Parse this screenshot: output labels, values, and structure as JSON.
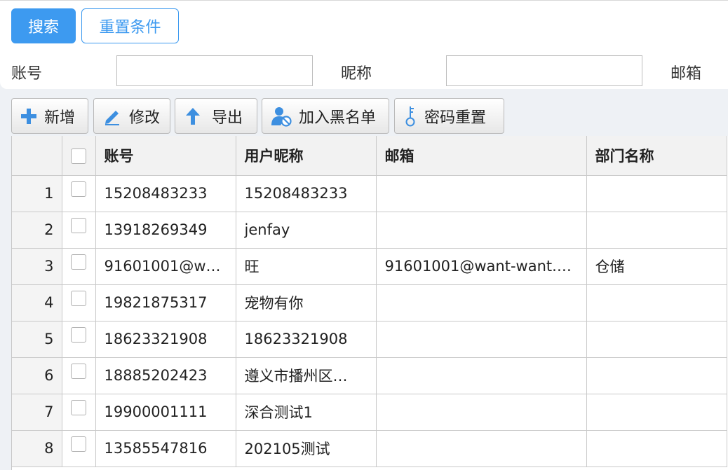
{
  "search": {
    "search_label": "搜索",
    "reset_label": "重置条件",
    "fields": [
      {
        "label": "账号",
        "value": ""
      },
      {
        "label": "昵称",
        "value": ""
      },
      {
        "label": "邮箱",
        "value": ""
      }
    ]
  },
  "toolbar": {
    "add_label": "新增",
    "edit_label": "修改",
    "export_label": "导出",
    "blacklist_label": "加入黑名单",
    "reset_password_label": "密码重置"
  },
  "table": {
    "columns": [
      "账号",
      "用户昵称",
      "邮箱",
      "部门名称"
    ],
    "rows": [
      {
        "no": "1",
        "account": "15208483233",
        "nickname": "15208483233",
        "email": "",
        "dept": ""
      },
      {
        "no": "2",
        "account": "13918269349",
        "nickname": "jenfay",
        "email": "",
        "dept": ""
      },
      {
        "no": "3",
        "account": "91601001@w…",
        "nickname": "旺",
        "email": "91601001@want-want.…",
        "dept": "仓储"
      },
      {
        "no": "4",
        "account": "19821875317",
        "nickname": "宠物有你",
        "email": "",
        "dept": ""
      },
      {
        "no": "5",
        "account": "18623321908",
        "nickname": "18623321908",
        "email": "",
        "dept": ""
      },
      {
        "no": "6",
        "account": "18885202423",
        "nickname": "遵义市播州区…",
        "email": "",
        "dept": ""
      },
      {
        "no": "7",
        "account": "19900001111",
        "nickname": "深合测试1",
        "email": "",
        "dept": ""
      },
      {
        "no": "8",
        "account": "13585547816",
        "nickname": "202105测试",
        "email": "",
        "dept": ""
      }
    ]
  },
  "colors": {
    "primary": "#3d9af0",
    "icon_blue": "#3d8fe0"
  }
}
